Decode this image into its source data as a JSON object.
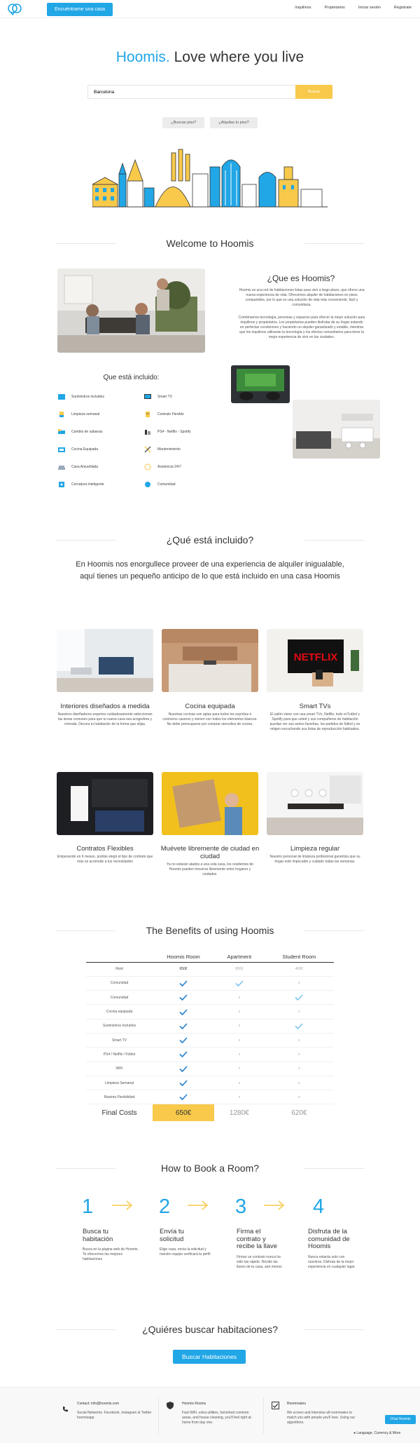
{
  "nav": {
    "cta_label": "Encuéntrame una casa",
    "links": [
      "Inquilinos",
      "Propietarios",
      "Iniciar sesión",
      "Registrate"
    ]
  },
  "hero": {
    "brand": "Hoomis.",
    "tagline": "Love where you live",
    "search_value": "Barcelona",
    "search_button": "Buscar",
    "pill_1": "¿Buscas piso?",
    "pill_2": "¿Alquilas tu piso?"
  },
  "welcome": {
    "title": "Welcome to Hoomis",
    "whatis_title": "¿Que es Hoomis?",
    "para1": "Hoomis es una red de habitaciones listas para vivir a largo plazo, que ofrece una nueva experiencia de vida. Ofrecemos alquiler de habitaciones en pisos compartidos, por lo que es una solución de vida más conveniente, fácil y comunitaria.",
    "para2": "Combinamos tecnología, personas y espacios para ofrecer la mejor solución para inquilinos y propietarios. Los propietarios pueden disfrutar de su hogar estando en perfectas condiciones y haciendo un alquiler garantizado y estable, mientras que los inquilinos utilizarán la tecnología y los efectos comunitarios para tener la mejor experiencia de vivir en las ciudades.",
    "included_title": "Que está incluido:",
    "included_left": [
      "Suministros incluidos",
      "Limpieza semanal",
      "Cambio de sabanas",
      "Cocina Equipada",
      "Casa Amueblada",
      "Cerradura inteligente"
    ],
    "included_right": [
      "Smart TV",
      "Contrato Flexible",
      "PS4 - Netflix - Spotify",
      "Mantenimiento",
      "Asistencia 24/7",
      "Comunidad"
    ]
  },
  "included": {
    "title": "¿Qué está incluido?",
    "subtitle": "En Hoomis nos enorgullece proveer de una experiencia de alquiler inigualable, aquí tienes un pequeño anticipo de lo que está incluido en una casa Hoomis",
    "cards": [
      {
        "title": "Interiores diseñados a medida",
        "desc": "Nuestros diseñadores expertos cuidadosamente seleccionan las áreas comunes para que tu nueva casa sea acogedora y cómoda. Decora tu habitación de la forma que elijas."
      },
      {
        "title": "Cocina equipada",
        "desc": "Nuestras cocinas son aptas para todos los espíritus e cocineros caseros y vienen con todos los elementos básicos. No debe preocuparse por comprar utensilios de cocina."
      },
      {
        "title": "Smart TVs",
        "desc": "El salón viene con una smart TVs, Netflix, todo el Futbol y Spotify para que usted y sus compañeros de habitación puedan ver sus series favoritas, los partidos de fútbol y se relajen escuchando sus listas de reproducción habituales."
      },
      {
        "title": "Contratos Flexibles",
        "desc": "Empezando en 6 meses, podrás elegir el tipo de contrato que más se acomode a tus necesidades"
      },
      {
        "title": "Muévete libremente de ciudad en ciudad",
        "desc": "Ya no estarán atados a una sola casa, los residentes de Hoomis pueden moverse libremente entre hogares y ciudades."
      },
      {
        "title": "Limpieza regular",
        "desc": "Nuestro personal de limpieza profesional garantiza que su hogar esté impecable y cuidado todas las semanas."
      }
    ],
    "netflix_text": "NETFLIX"
  },
  "benefits": {
    "title": "The Benefits of using Hoomis",
    "columns": [
      "Hoomis Room",
      "Apartment",
      "Student Room"
    ],
    "rows": [
      {
        "label": "Rent",
        "hoomis": "650€",
        "apartment": "800€",
        "student": "400€"
      },
      {
        "label": "Comunidad",
        "hoomis": "check",
        "apartment": "check-light",
        "student": "x"
      },
      {
        "label": "Comunidad",
        "hoomis": "check",
        "apartment": "x",
        "student": "check-light"
      },
      {
        "label": "Cocina equipada",
        "hoomis": "check",
        "apartment": "x",
        "student": "x"
      },
      {
        "label": "Suministros Incluidos",
        "hoomis": "check",
        "apartment": "x",
        "student": "check-light"
      },
      {
        "label": "Smart TV",
        "hoomis": "check",
        "apartment": "x",
        "student": "x"
      },
      {
        "label": "PS4 / Netflix / Fútbol",
        "hoomis": "check",
        "apartment": "x",
        "student": "x"
      },
      {
        "label": "WiFi",
        "hoomis": "check",
        "apartment": "x",
        "student": "x"
      },
      {
        "label": "Limpieza Semanal",
        "hoomis": "check",
        "apartment": "x",
        "student": "x"
      },
      {
        "label": "Maxima Flexibilidad",
        "hoomis": "check",
        "apartment": "x",
        "student": "x"
      }
    ],
    "x_mark": "x",
    "final_label": "Final Costs",
    "final_hoomis": "650€",
    "final_apartment": "1280€",
    "final_student": "620€"
  },
  "howto": {
    "title": "How to Book a Room?",
    "steps": [
      {
        "num": "1",
        "title": "Busca tu habitación",
        "desc": "Busca en la página web de Hoomis. Te ofrecemos las mejores habitaciones"
      },
      {
        "num": "2",
        "title": "Envía tu solicitud",
        "desc": "Elige casa, envía la solicitud y nuestro equipo verificará tu perfil"
      },
      {
        "num": "3",
        "title": "Firma el contrato y recibe la llave",
        "desc": "Firmar un contrato nunca ha sido tan rápido. Recibir las llaves de tu casa, aún menos"
      },
      {
        "num": "4",
        "title": "Disfruta de la comunidad de Hoomis",
        "desc": "Nunca estarás solo con nosotros. Disfruta de la mejor experiencia en cualquier lugar."
      }
    ]
  },
  "find": {
    "title": "¿Quiéres buscar habitaciones?",
    "button": "Buscar Habitaciones"
  },
  "footer": {
    "contact": "Contact: info@hoomis.com",
    "social": "Social Networks: Facebook, Instagram & Twitter hoomisapp",
    "rooms_title": "Hoomis Rooms",
    "rooms_desc": "Fast WiFi, extra utilities, furnished common areas, and house cleaning, you'll feel right at home from day one.",
    "roommates_title": "Roommates",
    "roommates_desc": "We screen and interview all roommates to match you with people you'll love. Using our algorithms.",
    "chat": "Chat Hoomis",
    "lang": "Language, Currency & More"
  },
  "colors": {
    "accent": "#21a6e6",
    "yellow": "#f8c94b"
  }
}
